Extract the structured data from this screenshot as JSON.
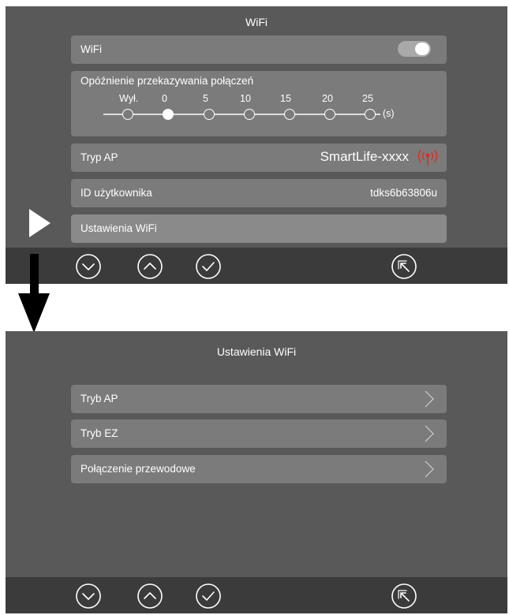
{
  "screen1": {
    "title": "WiFi",
    "wifi_label": "WiFi",
    "wifi_enabled": true,
    "delay": {
      "label": "Opóźnienie przekazywania połączeń",
      "options": [
        "Wył.",
        "0",
        "5",
        "10",
        "15",
        "20",
        "25"
      ],
      "unit": "(s)",
      "selected": "0"
    },
    "ap_row": {
      "label": "Tryp AP",
      "value": "SmartLife-xxxx"
    },
    "user_id_row": {
      "label": "ID użytkownika",
      "value": "tdks6b63806u"
    },
    "wifi_settings_row": {
      "label": "Ustawienia WiFi"
    }
  },
  "screen2": {
    "title": "Ustawienia WiFi",
    "items": [
      {
        "label": "Tryb AP"
      },
      {
        "label": "Tryb EZ"
      },
      {
        "label": "Połączenie przewodowe"
      }
    ]
  },
  "bottom_bar": {
    "icons": [
      "chevron-down-circle",
      "chevron-up-circle",
      "check-circle",
      "back-circle"
    ]
  },
  "colors": {
    "screen_bg": "#595959",
    "row_bg": "#7b7b7b",
    "bar_bg": "#3b3b3b",
    "signal_icon": "#d6302a"
  }
}
